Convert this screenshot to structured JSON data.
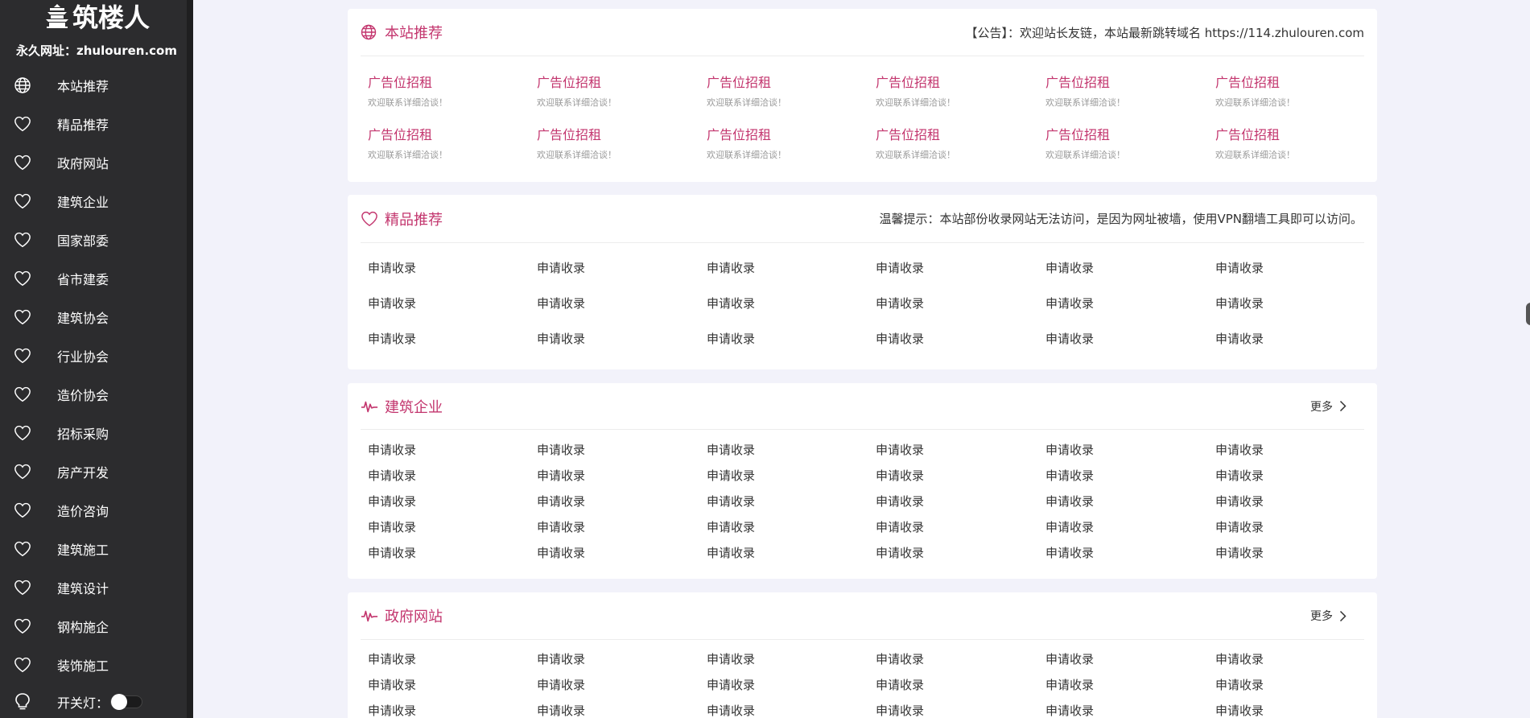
{
  "sidebar": {
    "logo_text": "筑楼人",
    "domain_text": "永久网址：zhulouren.com",
    "items": [
      {
        "label": "本站推荐",
        "icon": "globe-icon"
      },
      {
        "label": "精品推荐",
        "icon": "heart-icon"
      },
      {
        "label": "政府网站",
        "icon": "heart-icon"
      },
      {
        "label": "建筑企业",
        "icon": "heart-icon"
      },
      {
        "label": "国家部委",
        "icon": "heart-icon"
      },
      {
        "label": "省市建委",
        "icon": "heart-icon"
      },
      {
        "label": "建筑协会",
        "icon": "heart-icon"
      },
      {
        "label": "行业协会",
        "icon": "heart-icon"
      },
      {
        "label": "造价协会",
        "icon": "heart-icon"
      },
      {
        "label": "招标采购",
        "icon": "heart-icon"
      },
      {
        "label": "房产开发",
        "icon": "heart-icon"
      },
      {
        "label": "造价咨询",
        "icon": "heart-icon"
      },
      {
        "label": "建筑施工",
        "icon": "heart-icon"
      },
      {
        "label": "建筑设计",
        "icon": "heart-icon"
      },
      {
        "label": "钢构施企",
        "icon": "heart-icon"
      },
      {
        "label": "装饰施工",
        "icon": "heart-icon"
      }
    ],
    "lamp_label": "开关灯："
  },
  "colors": {
    "accent": "#c3366e",
    "sidebar_bg": "#2c2c2e",
    "page_bg": "#f2f2fa"
  },
  "sections": {
    "recommend": {
      "title": "本站推荐",
      "notice": "【公告】：欢迎站长友链，本站最新跳转域名 https://114.zhulouren.com",
      "ad_rows": [
        [
          {
            "title": "广告位招租",
            "sub": "欢迎联系详细洽谈！"
          },
          {
            "title": "广告位招租",
            "sub": "欢迎联系详细洽谈！"
          },
          {
            "title": "广告位招租",
            "sub": "欢迎联系详细洽谈！"
          },
          {
            "title": "广告位招租",
            "sub": "欢迎联系详细洽谈！"
          },
          {
            "title": "广告位招租",
            "sub": "欢迎联系详细洽谈！"
          },
          {
            "title": "广告位招租",
            "sub": "欢迎联系详细洽谈！"
          }
        ],
        [
          {
            "title": "广告位招租",
            "sub": "欢迎联系详细洽谈！"
          },
          {
            "title": "广告位招租",
            "sub": "欢迎联系详细洽谈！"
          },
          {
            "title": "广告位招租",
            "sub": "欢迎联系详细洽谈！"
          },
          {
            "title": "广告位招租",
            "sub": "欢迎联系详细洽谈！"
          },
          {
            "title": "广告位招租",
            "sub": "欢迎联系详细洽谈！"
          },
          {
            "title": "广告位招租",
            "sub": "欢迎联系详细洽谈！"
          }
        ]
      ]
    },
    "featured": {
      "title": "精品推荐",
      "notice": "温馨提示：本站部份收录网站无法访问，是因为网址被墙，使用VPN翻墙工具即可以访问。",
      "rows": [
        [
          "申请收录",
          "申请收录",
          "申请收录",
          "申请收录",
          "申请收录",
          "申请收录"
        ],
        [
          "申请收录",
          "申请收录",
          "申请收录",
          "申请收录",
          "申请收录",
          "申请收录"
        ],
        [
          "申请收录",
          "申请收录",
          "申请收录",
          "申请收录",
          "申请收录",
          "申请收录"
        ]
      ]
    },
    "construction": {
      "title": "建筑企业",
      "more": "更多",
      "rows": [
        [
          "申请收录",
          "申请收录",
          "申请收录",
          "申请收录",
          "申请收录",
          "申请收录"
        ],
        [
          "申请收录",
          "申请收录",
          "申请收录",
          "申请收录",
          "申请收录",
          "申请收录"
        ],
        [
          "申请收录",
          "申请收录",
          "申请收录",
          "申请收录",
          "申请收录",
          "申请收录"
        ],
        [
          "申请收录",
          "申请收录",
          "申请收录",
          "申请收录",
          "申请收录",
          "申请收录"
        ],
        [
          "申请收录",
          "申请收录",
          "申请收录",
          "申请收录",
          "申请收录",
          "申请收录"
        ]
      ]
    },
    "government": {
      "title": "政府网站",
      "more": "更多",
      "rows": [
        [
          "申请收录",
          "申请收录",
          "申请收录",
          "申请收录",
          "申请收录",
          "申请收录"
        ],
        [
          "申请收录",
          "申请收录",
          "申请收录",
          "申请收录",
          "申请收录",
          "申请收录"
        ],
        [
          "申请收录",
          "申请收录",
          "申请收录",
          "申请收录",
          "申请收录",
          "申请收录"
        ]
      ]
    }
  }
}
